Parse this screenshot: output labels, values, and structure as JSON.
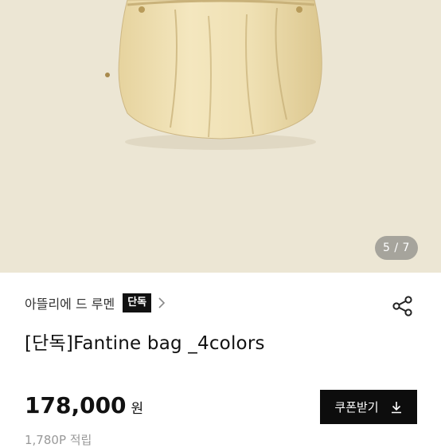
{
  "gallery": {
    "counter": "5 / 7"
  },
  "product": {
    "brand": "아뜰리에 드 루멘",
    "badge": "단독",
    "title": "[단독]Fantine bag _4colors",
    "price": "178,000",
    "currency": "원",
    "points": "1,780P 적립"
  },
  "actions": {
    "coupon_label": "쿠폰받기"
  },
  "colors": {
    "hero_bg": "#ece6d4",
    "bag": "#f1e3b8",
    "accent": "#0d0d0d"
  },
  "icons": [
    "share-icon",
    "chevron-right-icon",
    "download-icon"
  ]
}
